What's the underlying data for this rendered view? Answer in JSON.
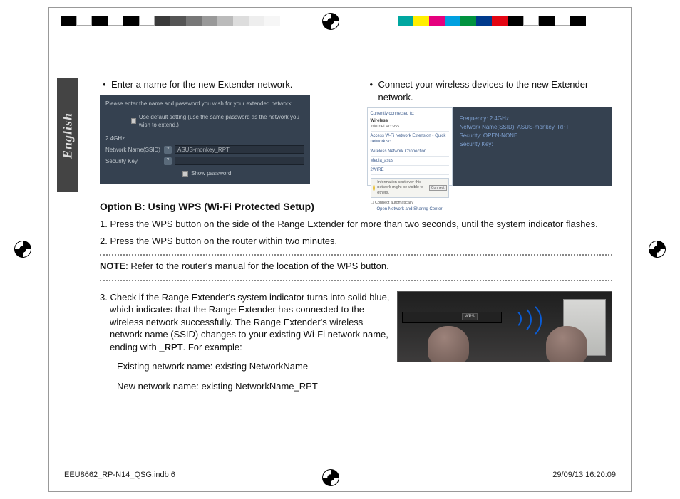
{
  "side_tab": "English",
  "left_bullet": "Enter a name for the new Extender network.",
  "right_bullet": "Connect your wireless devices to the new Extender network.",
  "dlg1": {
    "top": "Please enter the name and password you wish for your extended network.",
    "use_default": "Use default setting (use the same password as the network you wish to extend.)",
    "band": "2.4GHz",
    "ssid_label": "Network Name(SSID)",
    "ssid_value": "ASUS-monkey_RPT",
    "key_label": "Security Key",
    "show_pw": "Show password"
  },
  "dlg2_left": {
    "connected": "Currently connected to:",
    "wireless": "Wireless",
    "access": "Internet access",
    "l1": "Access W-Fi Network Extension - Quick network sc...",
    "l2": "Wireless Network Connection",
    "l3": "Media_asus",
    "l4": "2WIRE",
    "warn": "Information sent over this network might be visible to others.",
    "connect": "Connect",
    "auto": "Connect automatically",
    "bot": "Open Network and Sharing Center"
  },
  "dlg2_right": {
    "l1": "Frequency: 2.4GHz",
    "l2": "Network Name(SSID): ASUS-monkey_RPT",
    "l3": "Security: OPEN-NONE",
    "l4": "Security Key:"
  },
  "option_b_title": "Option B: Using WPS (Wi-Fi Protected Setup)",
  "step1_n": "1. ",
  "step1": "Press the WPS button on the side of the Range Extender for more than two seconds, until the system indicator flashes.",
  "step2_n": "2. ",
  "step2": "Press the WPS button on the router within two minutes.",
  "note_label": "NOTE",
  "note_rest": ": Refer to the router's manual for the location of the WPS button.",
  "step3_n": "3. ",
  "step3_a": "Check if the Range Extender's system indicator turns into solid blue, which indicates that the Range Extender has connected to the wireless network successfully. The Range Extender's wireless network name (SSID) changes to your existing Wi-Fi network name, ending with ",
  "step3_rpt": "_RPT",
  "step3_b": ". For example:",
  "step3_ex1": "Existing network name: existing NetworkName",
  "step3_ex2": "New network name: existing NetworkName_RPT",
  "wps_btn": "WPS",
  "footer_left": "EEU8662_RP-N14_QSG.indb   6",
  "footer_right": "29/09/13   16:20:09"
}
